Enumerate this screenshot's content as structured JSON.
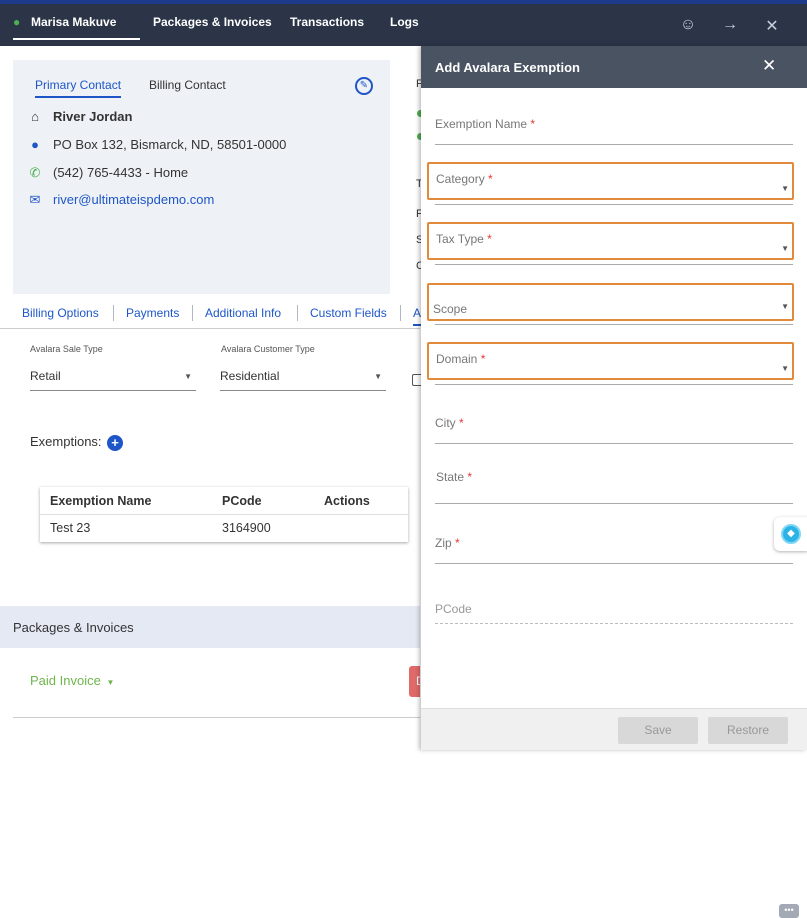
{
  "topbar": {
    "tabs": [
      {
        "label": "Marisa Makuve"
      },
      {
        "label": "Packages & Invoices"
      },
      {
        "label": "Transactions"
      },
      {
        "label": "Logs"
      }
    ],
    "icons": [
      "smiley-icon",
      "arrow-right-icon",
      "close-icon"
    ]
  },
  "contact": {
    "tabs": [
      "Primary Contact",
      "Billing Contact"
    ],
    "name": "River Jordan",
    "address": "PO Box 132, Bismarck, ND, 58501-0000",
    "phone": "(542) 765-4433 - Home",
    "email": "river@ultimateispdemo.com"
  },
  "subtabs": [
    "Billing Options",
    "Payments",
    "Additional Info",
    "Custom Fields",
    "Av"
  ],
  "avalara": {
    "sale_type_label": "Avalara Sale Type",
    "sale_type_value": "Retail",
    "customer_type_label": "Avalara Customer Type",
    "customer_type_value": "Residential"
  },
  "exemptions": {
    "label": "Exemptions:",
    "columns": [
      "Exemption Name",
      "PCode",
      "Actions"
    ],
    "rows": [
      {
        "name": "Test 23",
        "pcode": "3164900"
      }
    ]
  },
  "packages": {
    "title": "Packages & Invoices",
    "filter": "Paid Invoice",
    "stub": "D"
  },
  "status_peek": [
    "F",
    "T",
    "F",
    "S",
    "C"
  ],
  "panel": {
    "title": "Add Avalara Exemption",
    "fields": {
      "exemption_name": "Exemption Name",
      "category": "Category",
      "tax_type": "Tax Type",
      "scope": "Scope",
      "domain": "Domain",
      "city": "City",
      "state": "State",
      "zip": "Zip",
      "pcode": "PCode"
    },
    "required_mark": "*",
    "save_label": "Save",
    "restore_label": "Restore"
  },
  "colors": {
    "topbar": "#2b3547",
    "accent": "#1e56c8",
    "highlight_border": "#e28a3b",
    "paid_green": "#6fb54e",
    "required_red": "#e53935"
  }
}
